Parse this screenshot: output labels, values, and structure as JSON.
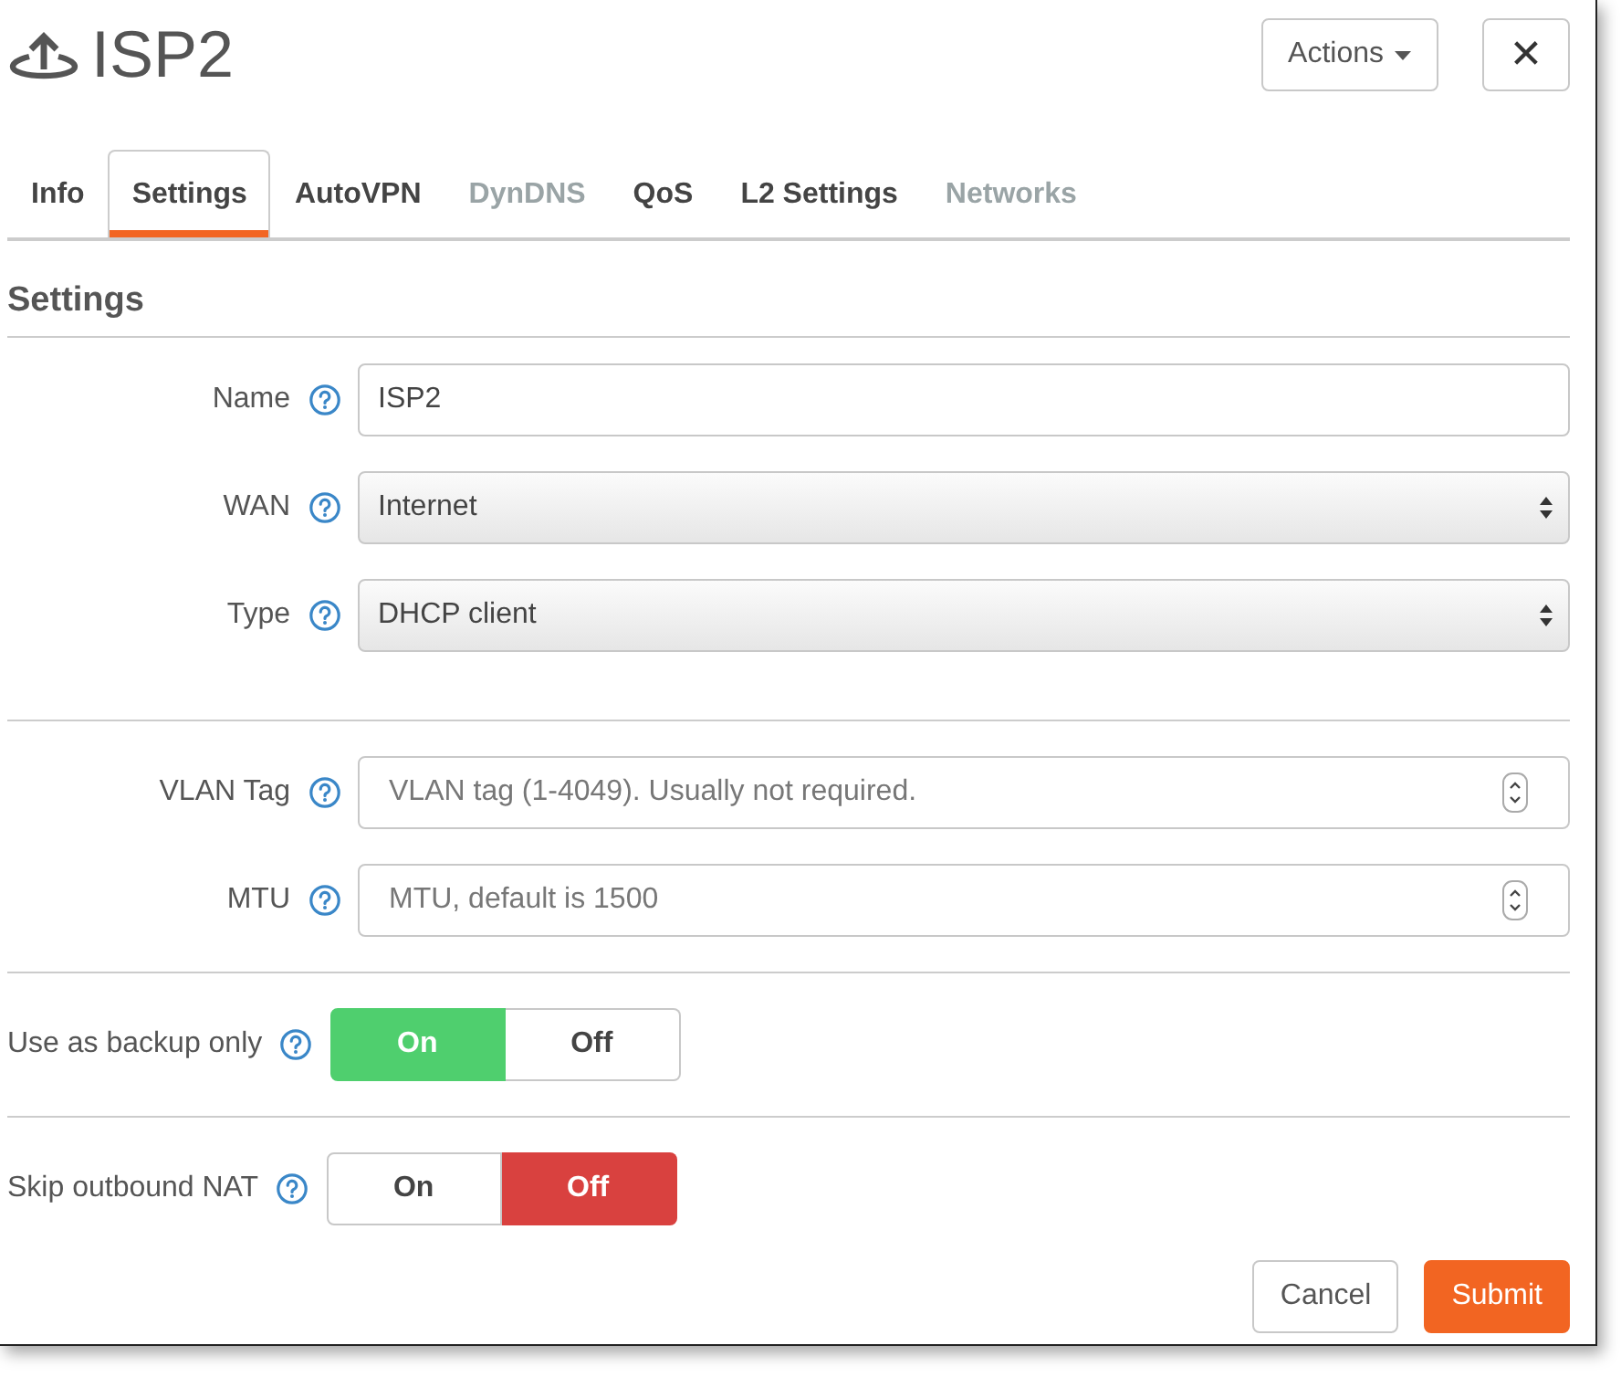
{
  "header": {
    "title": "ISP2",
    "actions_button": "Actions",
    "close_button": "✕"
  },
  "tabs": [
    {
      "label": "Info",
      "selected": false,
      "disabled": false
    },
    {
      "label": "Settings",
      "selected": true,
      "disabled": false
    },
    {
      "label": "AutoVPN",
      "selected": false,
      "disabled": false
    },
    {
      "label": "DynDNS",
      "selected": false,
      "disabled": true
    },
    {
      "label": "QoS",
      "selected": false,
      "disabled": false
    },
    {
      "label": "L2 Settings",
      "selected": false,
      "disabled": false
    },
    {
      "label": "Networks",
      "selected": false,
      "disabled": true
    }
  ],
  "section_title": "Settings",
  "field_groups": [
    [
      {
        "label": "Name",
        "kind": "text",
        "value": "ISP2"
      },
      {
        "label": "WAN",
        "kind": "select",
        "value": "Internet"
      },
      {
        "label": "Type",
        "kind": "select",
        "value": "DHCP client"
      }
    ],
    [
      {
        "label": "VLAN Tag",
        "kind": "number",
        "placeholder": "VLAN tag (1-4049). Usually not required."
      },
      {
        "label": "MTU",
        "kind": "number",
        "placeholder": "MTU, default is 1500"
      }
    ]
  ],
  "toggles": [
    {
      "label": "Use as backup only",
      "color": "#4fcf6e",
      "options": [
        {
          "label": "On",
          "selected": true
        },
        {
          "label": "Off",
          "selected": false
        }
      ]
    },
    {
      "label": "Skip outbound NAT",
      "color": "#d9413f",
      "options": [
        {
          "label": "On",
          "selected": false
        },
        {
          "label": "Off",
          "selected": true
        }
      ]
    }
  ],
  "footer": {
    "cancel_button": "Cancel",
    "submit_button": "Submit"
  }
}
